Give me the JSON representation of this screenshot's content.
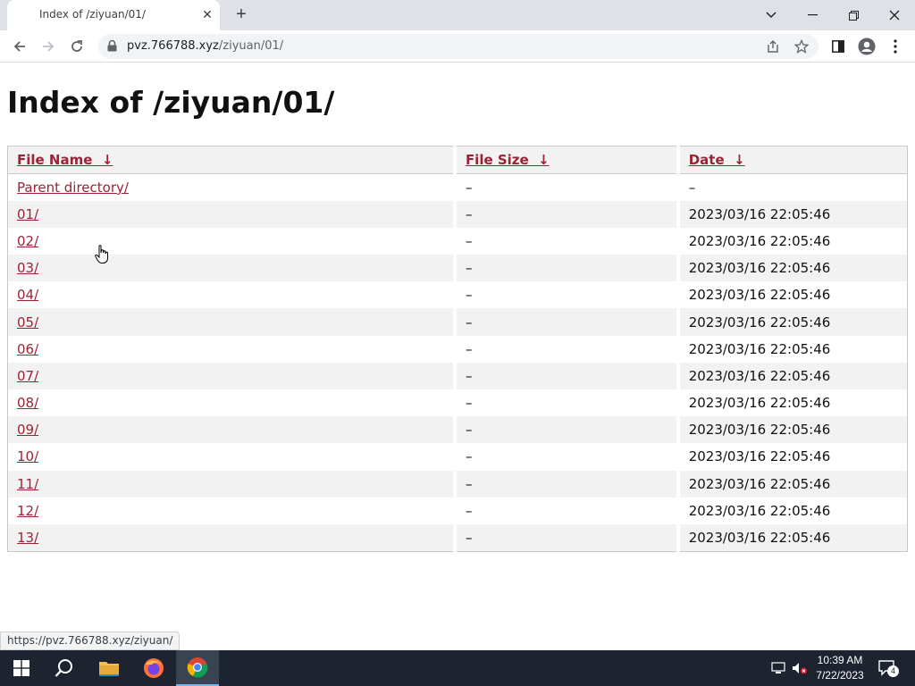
{
  "browser": {
    "tab_title": "Index of /ziyuan/01/",
    "tab_close": "✕",
    "new_tab": "+",
    "url_host": "pvz.766788.xyz",
    "url_path": "/ziyuan/01/",
    "status_url": "https://pvz.766788.xyz/ziyuan/"
  },
  "page": {
    "heading": "Index of /ziyuan/01/",
    "columns": {
      "name": "File Name",
      "size": "File Size",
      "date": "Date",
      "sort_arrow": "↓"
    },
    "rows": [
      {
        "name": "Parent directory/",
        "size": "–",
        "date": "–"
      },
      {
        "name": "01/",
        "size": "–",
        "date": "2023/03/16 22:05:46"
      },
      {
        "name": "02/",
        "size": "–",
        "date": "2023/03/16 22:05:46"
      },
      {
        "name": "03/",
        "size": "–",
        "date": "2023/03/16 22:05:46"
      },
      {
        "name": "04/",
        "size": "–",
        "date": "2023/03/16 22:05:46"
      },
      {
        "name": "05/",
        "size": "–",
        "date": "2023/03/16 22:05:46"
      },
      {
        "name": "06/",
        "size": "–",
        "date": "2023/03/16 22:05:46"
      },
      {
        "name": "07/",
        "size": "–",
        "date": "2023/03/16 22:05:46"
      },
      {
        "name": "08/",
        "size": "–",
        "date": "2023/03/16 22:05:46"
      },
      {
        "name": "09/",
        "size": "–",
        "date": "2023/03/16 22:05:46"
      },
      {
        "name": "10/",
        "size": "–",
        "date": "2023/03/16 22:05:46"
      },
      {
        "name": "11/",
        "size": "–",
        "date": "2023/03/16 22:05:46"
      },
      {
        "name": "12/",
        "size": "–",
        "date": "2023/03/16 22:05:46"
      },
      {
        "name": "13/",
        "size": "–",
        "date": "2023/03/16 22:05:46"
      }
    ]
  },
  "taskbar": {
    "time": "10:39 AM",
    "date": "7/22/2023",
    "notification_count": "4"
  },
  "colors": {
    "link": "#9b2335",
    "taskbar": "#1d2430",
    "chrome_tabbar": "#dee1e6"
  }
}
